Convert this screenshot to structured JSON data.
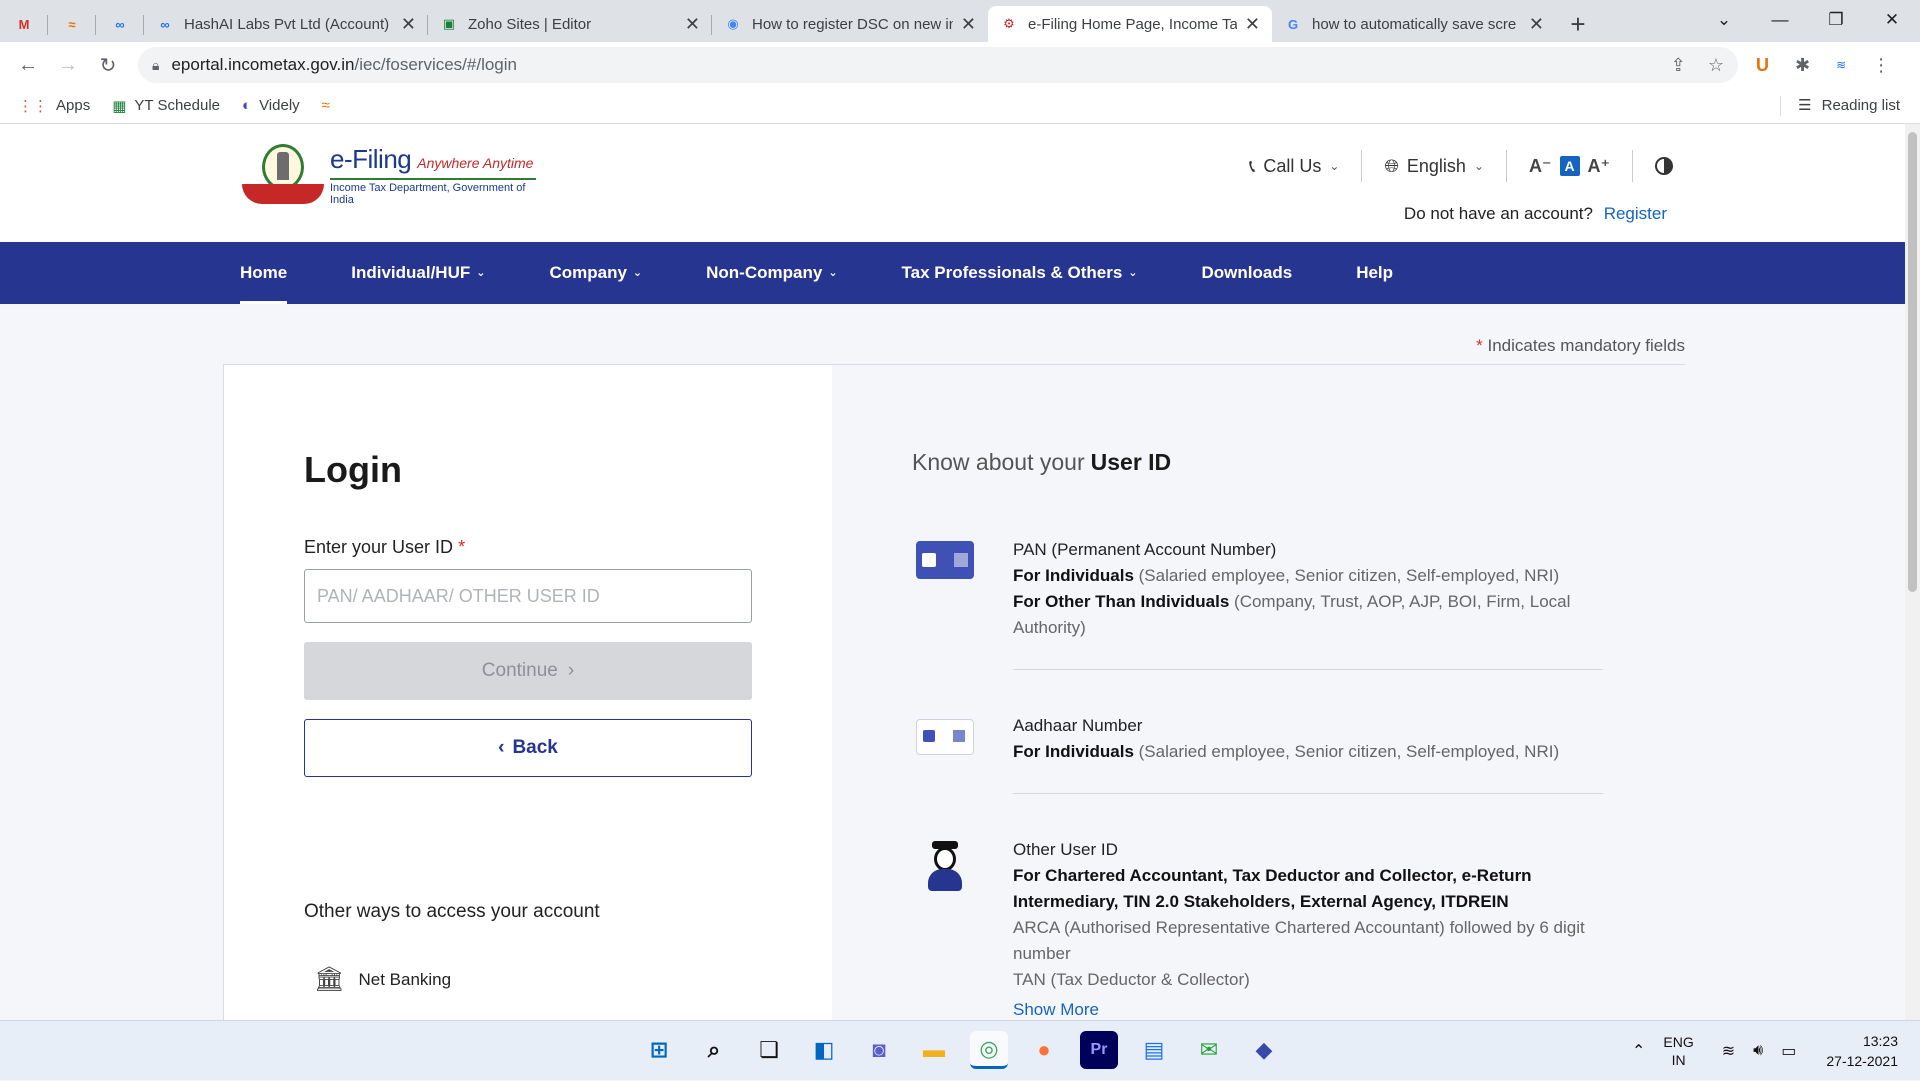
{
  "browser": {
    "tabs": [
      {
        "title": "",
        "icon": "M",
        "pinned": true
      },
      {
        "title": "",
        "icon": "≈",
        "pinned": true
      },
      {
        "title": "",
        "icon": "∞",
        "pinned": true
      },
      {
        "title": "HashAI Labs Pvt Ltd (Account)",
        "icon": "∞",
        "pinned": false
      },
      {
        "title": "Zoho Sites | Editor",
        "icon": "▣",
        "pinned": false
      },
      {
        "title": "How to register DSC on new in",
        "icon": "◉",
        "pinned": false
      },
      {
        "title": "e-Filing Home Page, Income Ta",
        "icon": "⚙",
        "pinned": false,
        "active": true
      },
      {
        "title": "how to automatically save scre",
        "icon": "G",
        "pinned": false
      }
    ],
    "new_tab_symbol": "+",
    "url_host": "eportal.incometax.gov.in",
    "url_path": "/iec/foservices/#/login",
    "bookmarks": [
      {
        "label": "Apps",
        "icon": "⋮⋮"
      },
      {
        "label": "YT Schedule",
        "icon": "▦"
      },
      {
        "label": "Videly",
        "icon": "◐"
      },
      {
        "label": "",
        "icon": "≈"
      }
    ],
    "reading_list": "Reading list"
  },
  "site": {
    "logo_title": "e-Filing",
    "logo_tagline": "Anywhere Anytime",
    "logo_subtitle": "Income Tax Department, Government of India",
    "call_us": "Call Us",
    "language": "English",
    "font_decrease": "A⁻",
    "font_default": "A",
    "font_increase": "A⁺",
    "no_account_text": "Do not have an account?",
    "register_link": "Register",
    "nav": [
      {
        "label": "Home",
        "dropdown": false,
        "active": true
      },
      {
        "label": "Individual/HUF",
        "dropdown": true
      },
      {
        "label": "Company",
        "dropdown": true
      },
      {
        "label": "Non-Company",
        "dropdown": true
      },
      {
        "label": "Tax Professionals & Others",
        "dropdown": true
      },
      {
        "label": "Downloads",
        "dropdown": false
      },
      {
        "label": "Help",
        "dropdown": false
      }
    ],
    "mandatory_note": "Indicates mandatory fields"
  },
  "login": {
    "title": "Login",
    "user_id_label": "Enter your User ID",
    "user_id_value": "",
    "user_id_placeholder": "PAN/ AADHAAR/ OTHER USER ID",
    "continue_label": "Continue",
    "back_label": "Back",
    "other_ways": "Other ways to access your account",
    "net_banking": "Net Banking"
  },
  "know": {
    "title_prefix": "Know about your",
    "title_strong": "User ID",
    "pan_heading": "PAN (Permanent Account Number)",
    "pan_ind_label": "For Individuals",
    "pan_ind_detail": "(Salaried employee, Senior citizen, Self-employed, NRI)",
    "pan_other_label": "For Other Than Individuals",
    "pan_other_detail": "(Company, Trust, AOP, AJP, BOI, Firm, Local Authority)",
    "aadhaar_heading": "Aadhaar Number",
    "aadhaar_ind_label": "For Individuals",
    "aadhaar_ind_detail": "(Salaried employee, Senior citizen, Self-employed, NRI)",
    "other_heading": "Other User ID",
    "other_strong": "For Chartered Accountant, Tax Deductor and Collector, e-Return Intermediary, TIN 2.0 Stakeholders, External Agency, ITDREIN",
    "other_arca": "ARCA (Authorised Representative Chartered Accountant) followed by 6 digit number",
    "other_tan": "TAN (Tax Deductor & Collector)",
    "show_more": "Show More"
  },
  "taskbar": {
    "lang_line1": "ENG",
    "lang_line2": "IN",
    "time": "13:23",
    "date": "27-12-2021"
  },
  "colors": {
    "nav_bg": "#26358f",
    "link": "#1565c0",
    "mandatory_star": "#d32f2f"
  }
}
